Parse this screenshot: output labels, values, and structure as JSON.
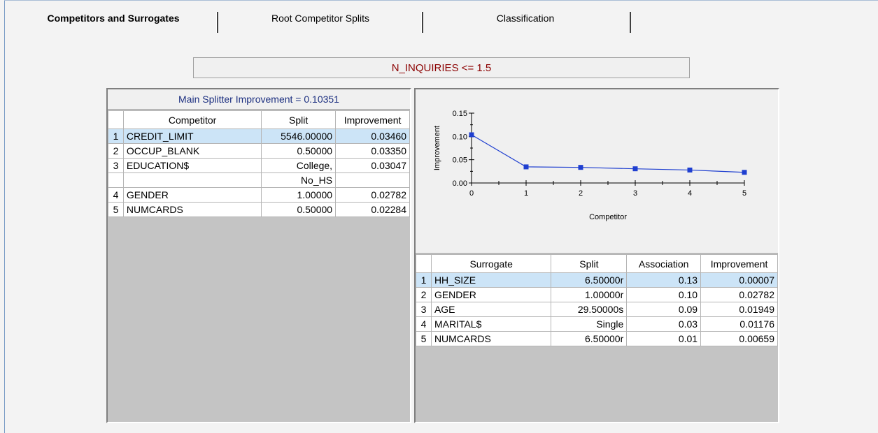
{
  "tabs": [
    {
      "label": "Competitors and Surrogates",
      "active": true
    },
    {
      "label": "Root Competitor Splits",
      "active": false
    },
    {
      "label": "Classification",
      "active": false
    }
  ],
  "node_title": "N_INQUIRIES <= 1.5",
  "main_splitter": "Main Splitter Improvement = 0.10351",
  "competitors": {
    "headers": [
      "Competitor",
      "Split",
      "Improvement"
    ],
    "rows": [
      {
        "idx": "1",
        "name": "CREDIT_LIMIT",
        "split": "5546.00000",
        "improvement": "0.03460",
        "selected": true
      },
      {
        "idx": "2",
        "name": "OCCUP_BLANK",
        "split": "0.50000",
        "improvement": "0.03350"
      },
      {
        "idx": "3",
        "name": "EDUCATION$",
        "split": "College,",
        "improvement": "0.03047"
      },
      {
        "idx": "",
        "name": "",
        "split": "No_HS",
        "improvement": ""
      },
      {
        "idx": "4",
        "name": "GENDER",
        "split": "1.00000",
        "improvement": "0.02782"
      },
      {
        "idx": "5",
        "name": "NUMCARDS",
        "split": "0.50000",
        "improvement": "0.02284"
      }
    ]
  },
  "surrogates": {
    "headers": [
      "Surrogate",
      "Split",
      "Association",
      "Improvement"
    ],
    "rows": [
      {
        "idx": "1",
        "name": "HH_SIZE",
        "split": "6.50000r",
        "association": "0.13",
        "improvement": "0.00007",
        "selected": true
      },
      {
        "idx": "2",
        "name": "GENDER",
        "split": "1.00000r",
        "association": "0.10",
        "improvement": "0.02782"
      },
      {
        "idx": "3",
        "name": "AGE",
        "split": "29.50000s",
        "association": "0.09",
        "improvement": "0.01949"
      },
      {
        "idx": "4",
        "name": "MARITAL$",
        "split": "Single",
        "association": "0.03",
        "improvement": "0.01176"
      },
      {
        "idx": "5",
        "name": "NUMCARDS",
        "split": "6.50000r",
        "association": "0.01",
        "improvement": "0.00659"
      }
    ]
  },
  "chart_data": {
    "type": "line",
    "xlabel": "Competitor",
    "ylabel": "Improvement",
    "x": [
      0,
      1,
      2,
      3,
      4,
      5
    ],
    "values": [
      0.10351,
      0.0346,
      0.0335,
      0.03047,
      0.02782,
      0.02284
    ],
    "xlim": [
      0,
      5
    ],
    "ylim": [
      0,
      0.15
    ],
    "x_ticks": [
      "0",
      "1",
      "2",
      "3",
      "4",
      "5"
    ],
    "y_ticks": [
      "0.00",
      "0.05",
      "0.10",
      "0.15"
    ],
    "color": "#1f3fd0"
  }
}
